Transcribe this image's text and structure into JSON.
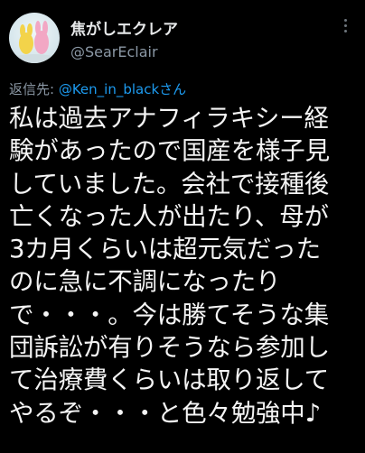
{
  "author": {
    "display_name": "焦がしエクレア",
    "handle": "@SearEclair"
  },
  "reply": {
    "label": "返信先: ",
    "mention": "@Ken_in_blackさん"
  },
  "tweet": {
    "lines": [
      "私は過去アナフィラキシー経",
      "験があったので国産を様子見",
      "していました。会社で接種後",
      "亡くなった人が出たり、母が",
      "3カ月くらいは超元気だった",
      "のに急に不調になったり",
      "で・・・。今は勝てそうな集",
      "団訴訟が有りそうなら参加し",
      "て治療費くらいは取り返して",
      "やるぞ・・・と色々勉強中♪"
    ]
  },
  "icons": {
    "avatar": "avatar-image",
    "more": "more-options-icon"
  },
  "colors": {
    "background": "#000000",
    "mention": "#1d9bf0",
    "secondary_text": "#8b98a5"
  }
}
